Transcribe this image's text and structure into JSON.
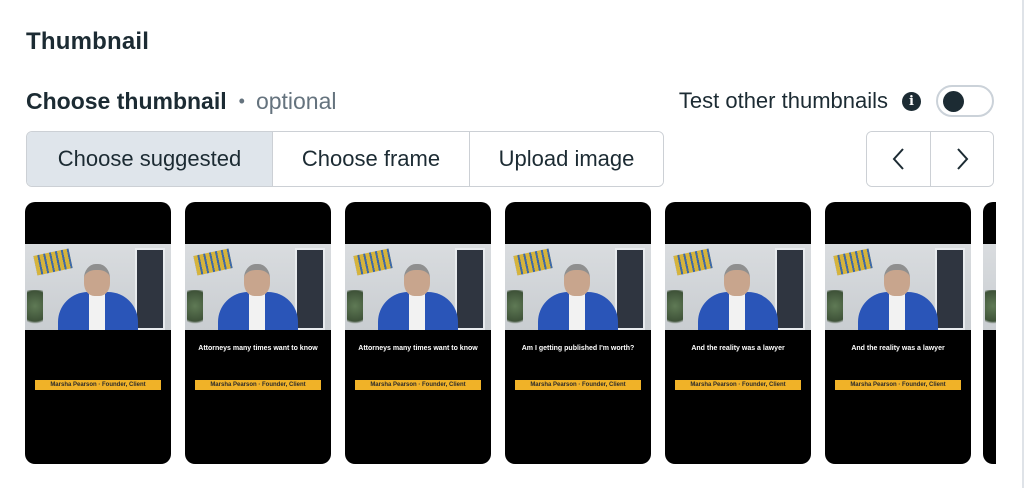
{
  "section": {
    "title": "Thumbnail"
  },
  "choose": {
    "title": "Choose thumbnail",
    "separator": "•",
    "optional": "optional"
  },
  "test_thumbnails": {
    "label": "Test other thumbnails",
    "info_glyph": "i",
    "toggle_on": false
  },
  "tabs": [
    {
      "label": "Choose suggested",
      "active": true
    },
    {
      "label": "Choose frame",
      "active": false
    },
    {
      "label": "Upload image",
      "active": false
    }
  ],
  "nav": {
    "prev_icon": "chevron-left-icon",
    "next_icon": "chevron-right-icon"
  },
  "thumbnails": [
    {
      "caption": "",
      "nameplate": "Marsha Pearson · Founder, Client"
    },
    {
      "caption": "Attorneys many times want to know",
      "nameplate": "Marsha Pearson · Founder, Client"
    },
    {
      "caption": "Attorneys many times want to know",
      "nameplate": "Marsha Pearson · Founder, Client"
    },
    {
      "caption": "Am I getting published I'm worth?",
      "nameplate": "Marsha Pearson · Founder, Client"
    },
    {
      "caption": "And the reality was a lawyer",
      "nameplate": "Marsha Pearson · Founder, Client"
    },
    {
      "caption": "And the reality was a lawyer",
      "nameplate": "Marsha Pearson · Founder, Client"
    }
  ],
  "colors": {
    "text_primary": "#1c2b33",
    "text_secondary": "#65737e",
    "active_tab_bg": "#dfe5eb",
    "border": "#ccd0d5",
    "nameplate": "#f0b228"
  }
}
